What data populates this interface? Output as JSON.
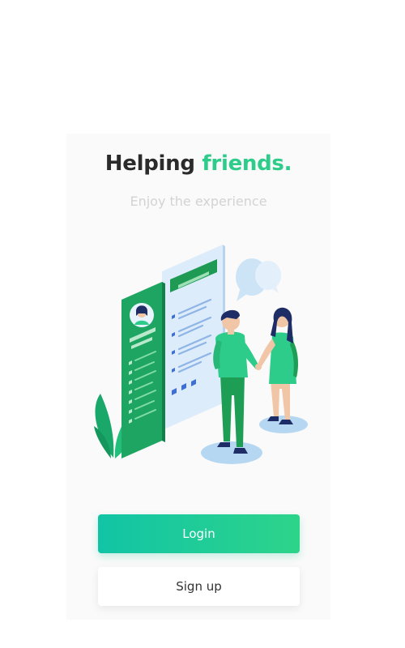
{
  "header": {
    "title_main": "Helping",
    "title_accent": "friends.",
    "subtitle": "Enjoy the experience"
  },
  "actions": {
    "login_label": "Login",
    "signup_label": "Sign up"
  },
  "colors": {
    "accent": "#2ecc8a",
    "login_gradient_start": "#12c4a6",
    "login_gradient_end": "#2dd48a",
    "title": "#2b2b2b",
    "subtitle": "#d3d3d3"
  },
  "illustration": {
    "icon": "resume-handshake-illustration"
  }
}
